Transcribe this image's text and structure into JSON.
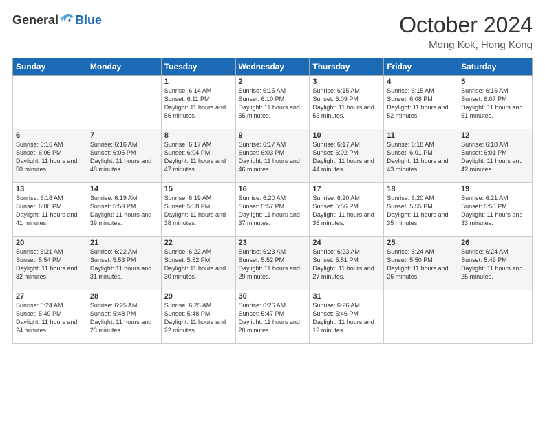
{
  "header": {
    "logo": {
      "general": "General",
      "blue": "Blue"
    },
    "title": "October 2024",
    "location": "Mong Kok, Hong Kong"
  },
  "weekdays": [
    "Sunday",
    "Monday",
    "Tuesday",
    "Wednesday",
    "Thursday",
    "Friday",
    "Saturday"
  ],
  "weeks": [
    [
      {
        "day": "",
        "sunrise": "",
        "sunset": "",
        "daylight": ""
      },
      {
        "day": "",
        "sunrise": "",
        "sunset": "",
        "daylight": ""
      },
      {
        "day": "1",
        "sunrise": "Sunrise: 6:14 AM",
        "sunset": "Sunset: 6:11 PM",
        "daylight": "Daylight: 11 hours and 56 minutes."
      },
      {
        "day": "2",
        "sunrise": "Sunrise: 6:15 AM",
        "sunset": "Sunset: 6:10 PM",
        "daylight": "Daylight: 11 hours and 55 minutes."
      },
      {
        "day": "3",
        "sunrise": "Sunrise: 6:15 AM",
        "sunset": "Sunset: 6:09 PM",
        "daylight": "Daylight: 11 hours and 53 minutes."
      },
      {
        "day": "4",
        "sunrise": "Sunrise: 6:15 AM",
        "sunset": "Sunset: 6:08 PM",
        "daylight": "Daylight: 11 hours and 52 minutes."
      },
      {
        "day": "5",
        "sunrise": "Sunrise: 6:16 AM",
        "sunset": "Sunset: 6:07 PM",
        "daylight": "Daylight: 11 hours and 51 minutes."
      }
    ],
    [
      {
        "day": "6",
        "sunrise": "Sunrise: 6:16 AM",
        "sunset": "Sunset: 6:06 PM",
        "daylight": "Daylight: 11 hours and 50 minutes."
      },
      {
        "day": "7",
        "sunrise": "Sunrise: 6:16 AM",
        "sunset": "Sunset: 6:05 PM",
        "daylight": "Daylight: 11 hours and 48 minutes."
      },
      {
        "day": "8",
        "sunrise": "Sunrise: 6:17 AM",
        "sunset": "Sunset: 6:04 PM",
        "daylight": "Daylight: 11 hours and 47 minutes."
      },
      {
        "day": "9",
        "sunrise": "Sunrise: 6:17 AM",
        "sunset": "Sunset: 6:03 PM",
        "daylight": "Daylight: 11 hours and 46 minutes."
      },
      {
        "day": "10",
        "sunrise": "Sunrise: 6:17 AM",
        "sunset": "Sunset: 6:02 PM",
        "daylight": "Daylight: 11 hours and 44 minutes."
      },
      {
        "day": "11",
        "sunrise": "Sunrise: 6:18 AM",
        "sunset": "Sunset: 6:01 PM",
        "daylight": "Daylight: 11 hours and 43 minutes."
      },
      {
        "day": "12",
        "sunrise": "Sunrise: 6:18 AM",
        "sunset": "Sunset: 6:01 PM",
        "daylight": "Daylight: 11 hours and 42 minutes."
      }
    ],
    [
      {
        "day": "13",
        "sunrise": "Sunrise: 6:18 AM",
        "sunset": "Sunset: 6:00 PM",
        "daylight": "Daylight: 11 hours and 41 minutes."
      },
      {
        "day": "14",
        "sunrise": "Sunrise: 6:19 AM",
        "sunset": "Sunset: 5:59 PM",
        "daylight": "Daylight: 11 hours and 39 minutes."
      },
      {
        "day": "15",
        "sunrise": "Sunrise: 6:19 AM",
        "sunset": "Sunset: 5:58 PM",
        "daylight": "Daylight: 11 hours and 38 minutes."
      },
      {
        "day": "16",
        "sunrise": "Sunrise: 6:20 AM",
        "sunset": "Sunset: 5:57 PM",
        "daylight": "Daylight: 11 hours and 37 minutes."
      },
      {
        "day": "17",
        "sunrise": "Sunrise: 6:20 AM",
        "sunset": "Sunset: 5:56 PM",
        "daylight": "Daylight: 11 hours and 36 minutes."
      },
      {
        "day": "18",
        "sunrise": "Sunrise: 6:20 AM",
        "sunset": "Sunset: 5:55 PM",
        "daylight": "Daylight: 11 hours and 35 minutes."
      },
      {
        "day": "19",
        "sunrise": "Sunrise: 6:21 AM",
        "sunset": "Sunset: 5:55 PM",
        "daylight": "Daylight: 11 hours and 33 minutes."
      }
    ],
    [
      {
        "day": "20",
        "sunrise": "Sunrise: 6:21 AM",
        "sunset": "Sunset: 5:54 PM",
        "daylight": "Daylight: 11 hours and 32 minutes."
      },
      {
        "day": "21",
        "sunrise": "Sunrise: 6:22 AM",
        "sunset": "Sunset: 5:53 PM",
        "daylight": "Daylight: 11 hours and 31 minutes."
      },
      {
        "day": "22",
        "sunrise": "Sunrise: 6:22 AM",
        "sunset": "Sunset: 5:52 PM",
        "daylight": "Daylight: 11 hours and 30 minutes."
      },
      {
        "day": "23",
        "sunrise": "Sunrise: 6:23 AM",
        "sunset": "Sunset: 5:52 PM",
        "daylight": "Daylight: 11 hours and 29 minutes."
      },
      {
        "day": "24",
        "sunrise": "Sunrise: 6:23 AM",
        "sunset": "Sunset: 5:51 PM",
        "daylight": "Daylight: 11 hours and 27 minutes."
      },
      {
        "day": "25",
        "sunrise": "Sunrise: 6:24 AM",
        "sunset": "Sunset: 5:50 PM",
        "daylight": "Daylight: 11 hours and 26 minutes."
      },
      {
        "day": "26",
        "sunrise": "Sunrise: 6:24 AM",
        "sunset": "Sunset: 5:49 PM",
        "daylight": "Daylight: 11 hours and 25 minutes."
      }
    ],
    [
      {
        "day": "27",
        "sunrise": "Sunrise: 6:24 AM",
        "sunset": "Sunset: 5:49 PM",
        "daylight": "Daylight: 11 hours and 24 minutes."
      },
      {
        "day": "28",
        "sunrise": "Sunrise: 6:25 AM",
        "sunset": "Sunset: 5:48 PM",
        "daylight": "Daylight: 11 hours and 23 minutes."
      },
      {
        "day": "29",
        "sunrise": "Sunrise: 6:25 AM",
        "sunset": "Sunset: 5:48 PM",
        "daylight": "Daylight: 11 hours and 22 minutes."
      },
      {
        "day": "30",
        "sunrise": "Sunrise: 6:26 AM",
        "sunset": "Sunset: 5:47 PM",
        "daylight": "Daylight: 11 hours and 20 minutes."
      },
      {
        "day": "31",
        "sunrise": "Sunrise: 6:26 AM",
        "sunset": "Sunset: 5:46 PM",
        "daylight": "Daylight: 11 hours and 19 minutes."
      },
      {
        "day": "",
        "sunrise": "",
        "sunset": "",
        "daylight": ""
      },
      {
        "day": "",
        "sunrise": "",
        "sunset": "",
        "daylight": ""
      }
    ]
  ]
}
